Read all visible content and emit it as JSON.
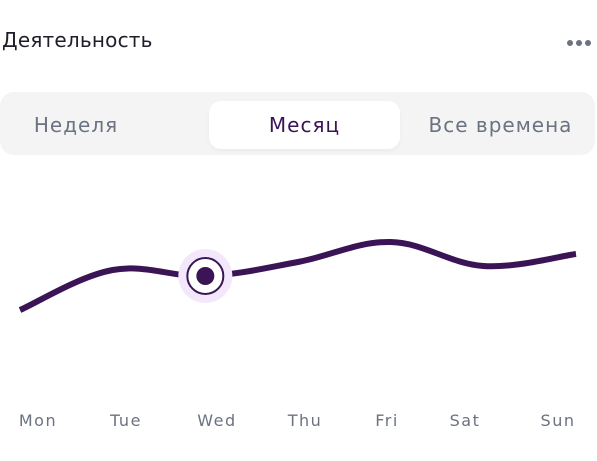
{
  "header": {
    "title": "Деятельность"
  },
  "menu": {
    "more_icon": "more-horizontal-icon"
  },
  "tabs": [
    {
      "label": "Неделя",
      "selected": false
    },
    {
      "label": "Месяц",
      "selected": true
    },
    {
      "label": "Все времена",
      "selected": false
    }
  ],
  "colors": {
    "line": "#3b1456",
    "highlight_ring": "#f3e8fb",
    "label": "#6b7280"
  },
  "chart_data": {
    "type": "line",
    "categories": [
      "Mon",
      "Tue",
      "Wed",
      "Thu",
      "Fri",
      "Sat",
      "Sun"
    ],
    "values": [
      1.0,
      3.0,
      2.7,
      3.4,
      4.4,
      3.2,
      3.8
    ],
    "highlighted_index": 2,
    "ylim": [
      0,
      6
    ],
    "grid": false
  }
}
